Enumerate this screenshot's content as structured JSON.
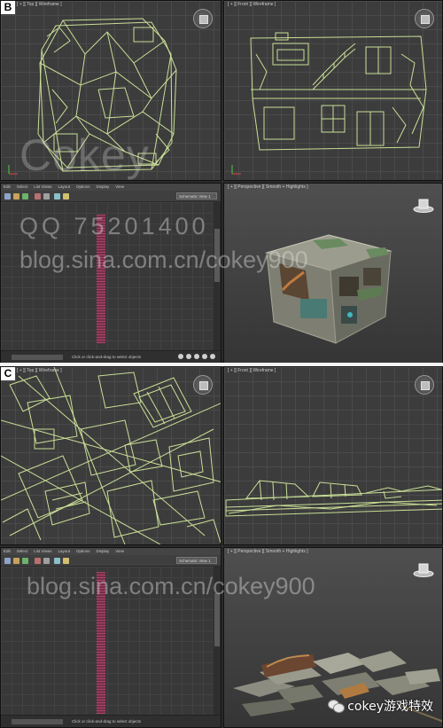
{
  "panel_b": {
    "letter": "B",
    "top_view_label": "[ + ][ Top ][ Wireframe ]",
    "front_view_label": "[ + ][ Front ][ Wireframe ]",
    "perspective_label": "[ + ][ Perspective ][ Smooth + Highlights ]",
    "editor": {
      "menu": [
        "Edit",
        "Select",
        "List Views",
        "Layout",
        "Options",
        "Display",
        "View"
      ],
      "view_dropdown": "Schematic View 1",
      "status_text": "Click or click-and-drag to select objects"
    }
  },
  "panel_c": {
    "letter": "C",
    "top_view_label": "[ + ][ Top ][ Wireframe ]",
    "front_view_label": "[ + ][ Front ][ Wireframe ]",
    "perspective_label": "[ + ][ Perspective ][ Smooth + Highlights ]",
    "editor": {
      "menu": [
        "Edit",
        "Select",
        "List Views",
        "Layout",
        "Options",
        "Display",
        "View"
      ],
      "view_dropdown": "Schematic View 1",
      "status_text": "Click or click-and-drag to select objects"
    }
  },
  "watermarks": {
    "cokey": "Cokey",
    "qq": "QQ  75201400",
    "blog_b": "blog.sina.com.cn/cokey900",
    "blog_c": "blog.sina.com.cn/cokey900",
    "wechat": "cokey游戏特效"
  },
  "colors": {
    "wireframe": "#d9f0a0",
    "viewport_bg": "#3c3c3c",
    "track_pink": "#b8456d"
  }
}
